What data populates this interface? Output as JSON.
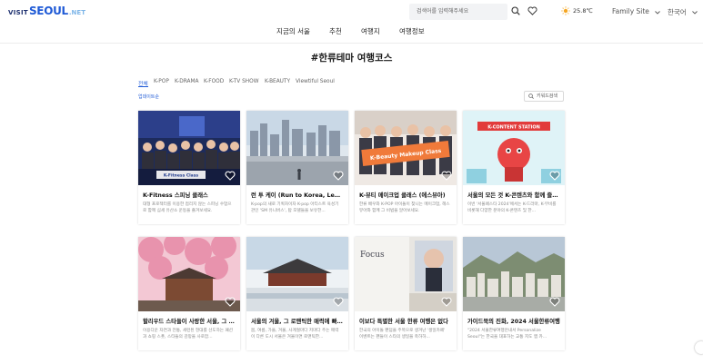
{
  "logo": {
    "visit": "VISIT",
    "seoul": "SEOUL",
    "net": ".NET"
  },
  "search": {
    "placeholder": "검색어를 입력해주세요"
  },
  "weather": {
    "temperature": "25.8℃"
  },
  "family_site": "Family Site",
  "language": "한국어",
  "gnb": [
    "지금의 서울",
    "추천",
    "여행지",
    "여행정보"
  ],
  "page_title": "#한류테마 여행코스",
  "tabs": [
    "전체",
    "K-POP",
    "K-DRAMA",
    "K-FOOD",
    "K-TV SHOW",
    "K-BEAUTY",
    "Viewtiful Seoul"
  ],
  "active_tab": "전체",
  "sort_label": "업데이트순",
  "keyword_search": "키워드검색",
  "cards": [
    {
      "title": "K-Fitness 스피닝 클래스",
      "desc": "대형 프로젝터를 이용한 접리지 않는 스피닝 수업으로 함께 심세 유산소 운동을 즐겨보세요."
    },
    {
      "title": "런 투 케이 (Run to Korea, Learn to K-pop)",
      "desc": "K-pop의 새로 기획자이자 K-pop 아티스트 육성기관인 'SM 유니버스', 탑 모델들을 보유한..."
    },
    {
      "title": "K-뷰티 메이크업 클래스 (에스뷰아)",
      "desc": "한류 배우와 K-POP 아이돌이 찾니는 메이크업, 헤스뷰아와 함께 그 비법을 알아보세요."
    },
    {
      "title": "서울의 모든 것 K-콘텐츠와 함께 즐기기",
      "desc": "이번 '서울페스타 2024'에서는 K-드라마, K-무비를 비롯해 다양한 분야의 K-콘텐츠 및 한..."
    },
    {
      "title": "할리우드 스타들이 사랑한 서울, 그 현장속으로",
      "desc": "이용다운 자연과 전통, 세련된 현대를 선도하는 패션과 쇼핑 스폿, 스타들의 감망을 사로잡..."
    },
    {
      "title": "서울의 겨울, 그 로맨틱한 매력에 빠지다",
      "desc": "봄, 여름, 가을, 겨울, 사계절마다 저마다 주는 매력이 다른 도시 서울은 겨울이면 로맨틱한..."
    },
    {
      "title": "이보다 특별한 서울 한류 여행은 없다",
      "desc": "한국의 아이돌 팬덤을 주목으로 생겨난 '생일카페' 이벤트는 팬들이 스타의 생일을 축하하..."
    },
    {
      "title": "가이드북의 진화, 2024 서울한류여행",
      "desc": "\"2024 서울한류여행안내서 Personalize Seoul\"는 한국을 대표하는 교통 지도 앱 카..."
    }
  ],
  "thumb_labels": [
    "K-Fitness Class",
    "K-Beauty Makeup Class",
    "K-CONTENT STATION",
    "Focus"
  ],
  "colors": {
    "accent": "#1f5ad6",
    "brand_navy": "#1c2f6e"
  }
}
